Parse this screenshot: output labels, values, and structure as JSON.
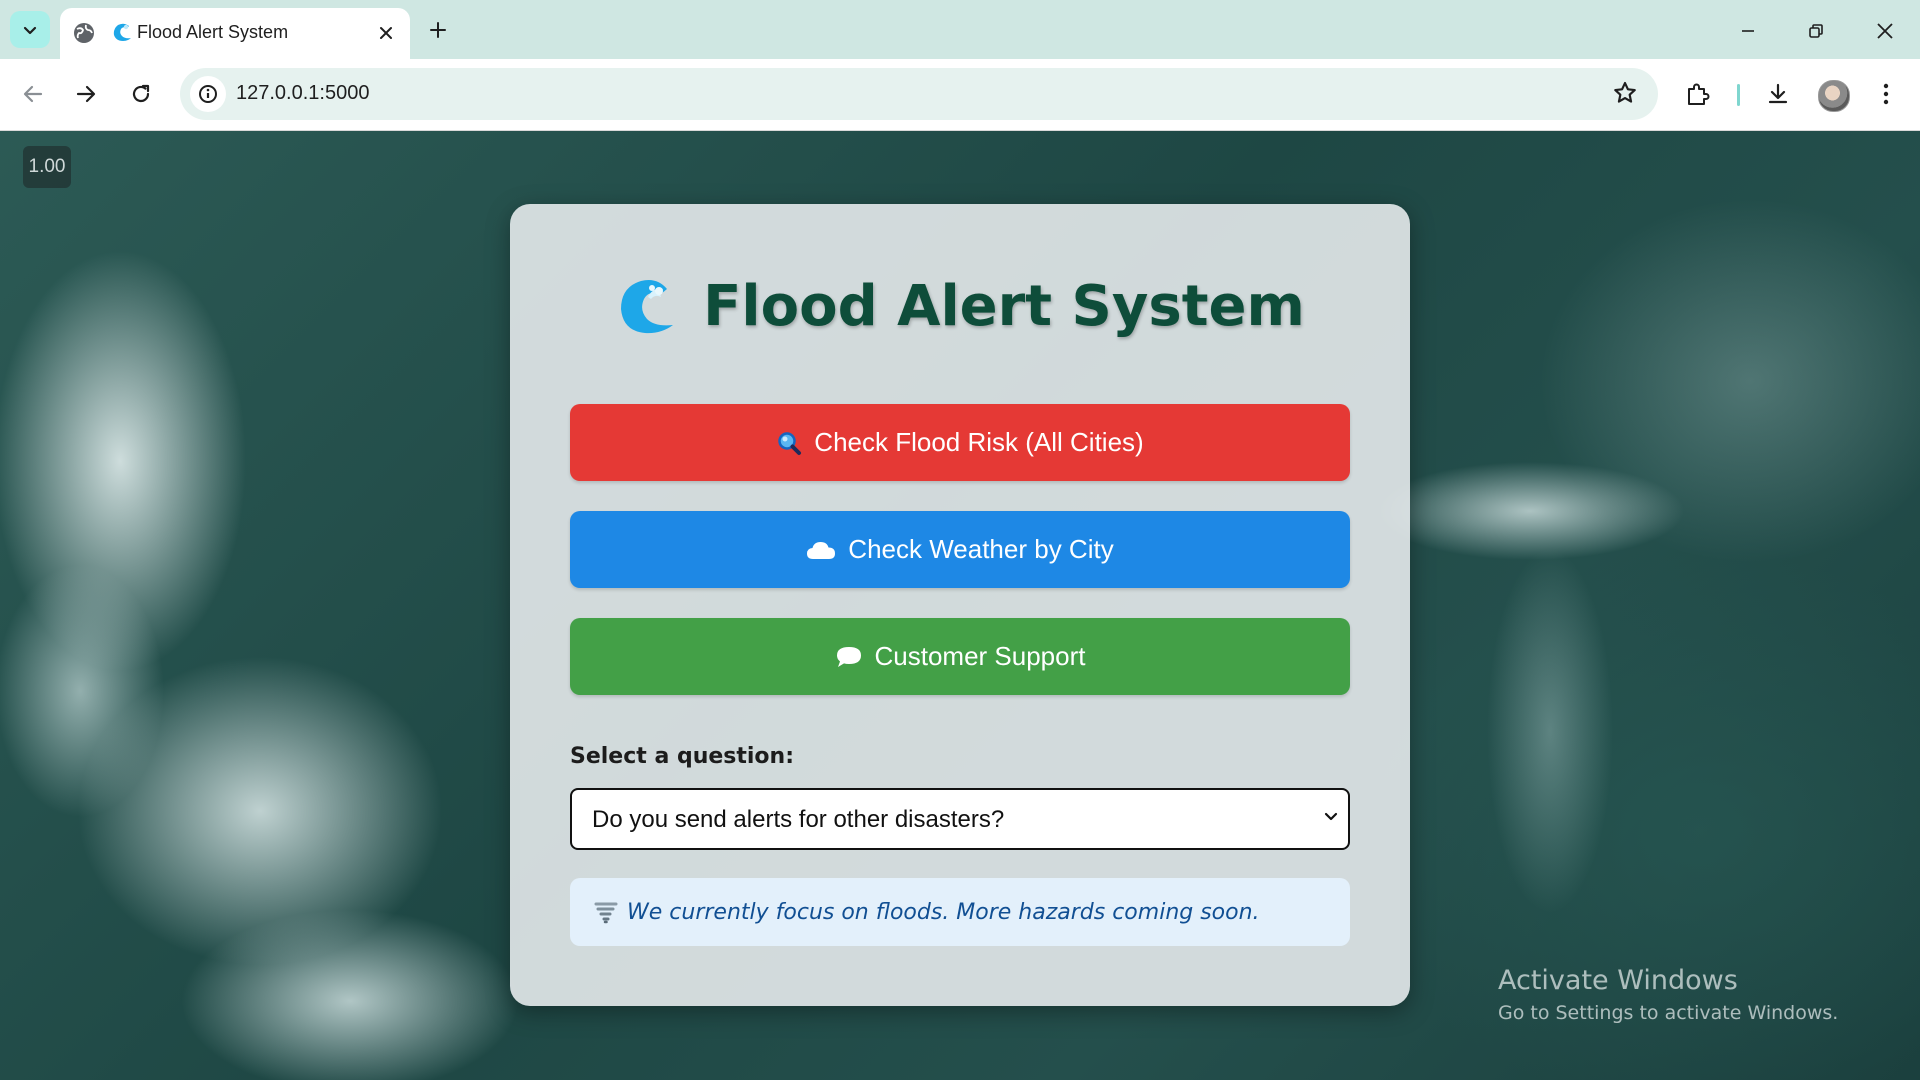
{
  "browser": {
    "tab": {
      "title": "Flood Alert System"
    },
    "url": "127.0.0.1:5000"
  },
  "page": {
    "zoom_badge": "1.00",
    "title": "Flood Alert System",
    "buttons": {
      "flood_risk": "Check Flood Risk (All Cities)",
      "weather": "Check Weather by City",
      "support": "Customer Support"
    },
    "select": {
      "label": "Select a question:",
      "value": "Do you send alerts for other disasters?"
    },
    "answer": "We currently focus on floods. More hazards coming soon."
  },
  "watermark": {
    "line1": "Activate Windows",
    "line2": "Go to Settings to activate Windows."
  },
  "colors": {
    "red_button": "#e53935",
    "blue_button": "#1e88e5",
    "green_button": "#43a047",
    "title": "#0e4d3a",
    "answer_text": "#114f93"
  },
  "icons": [
    "tab-search-icon",
    "globe-icon",
    "wave-favicon-icon",
    "close-icon",
    "plus-icon",
    "minimize-icon",
    "restore-icon",
    "back-icon",
    "forward-icon",
    "reload-icon",
    "info-icon",
    "star-icon",
    "extensions-icon",
    "download-icon",
    "menu-icon",
    "magnifier-icon",
    "cloud-icon",
    "speech-bubble-icon",
    "chevron-down-icon",
    "tornado-icon"
  ]
}
